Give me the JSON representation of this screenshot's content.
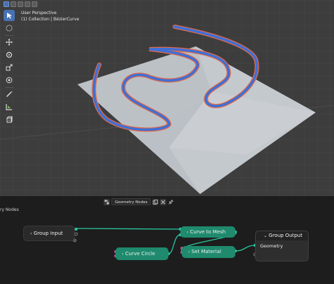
{
  "viewport": {
    "perspective_label": "User Perspective",
    "collection_label": "(1) Collection | BézierCurve",
    "colors": {
      "background": "#3d3d3d",
      "plane": "#c4c9ce",
      "curve_outer": "#e06a4a",
      "curve_inner": "#3f6fd6"
    }
  },
  "toolbar": {
    "icons": [
      "select-cursor-icon",
      "select-box-icon",
      "move-icon",
      "rotate-icon",
      "scale-icon",
      "transform-icon",
      "annotate-icon",
      "measure-icon",
      "add-cube-icon"
    ]
  },
  "node_editor": {
    "tree_name": "Geometry Nodes",
    "breadcrumb": "ry Nodes",
    "node_color": "#1f8a6d",
    "link_color": "#28c7a0",
    "nodes": {
      "group_input": "Group Input",
      "curve_to_mesh": "Curve to Mesh",
      "curve_circle": "Curve Circle",
      "set_material": "Set Material",
      "group_output": "Group Output",
      "geometry_socket": "Geometry"
    }
  },
  "chevron": "›"
}
